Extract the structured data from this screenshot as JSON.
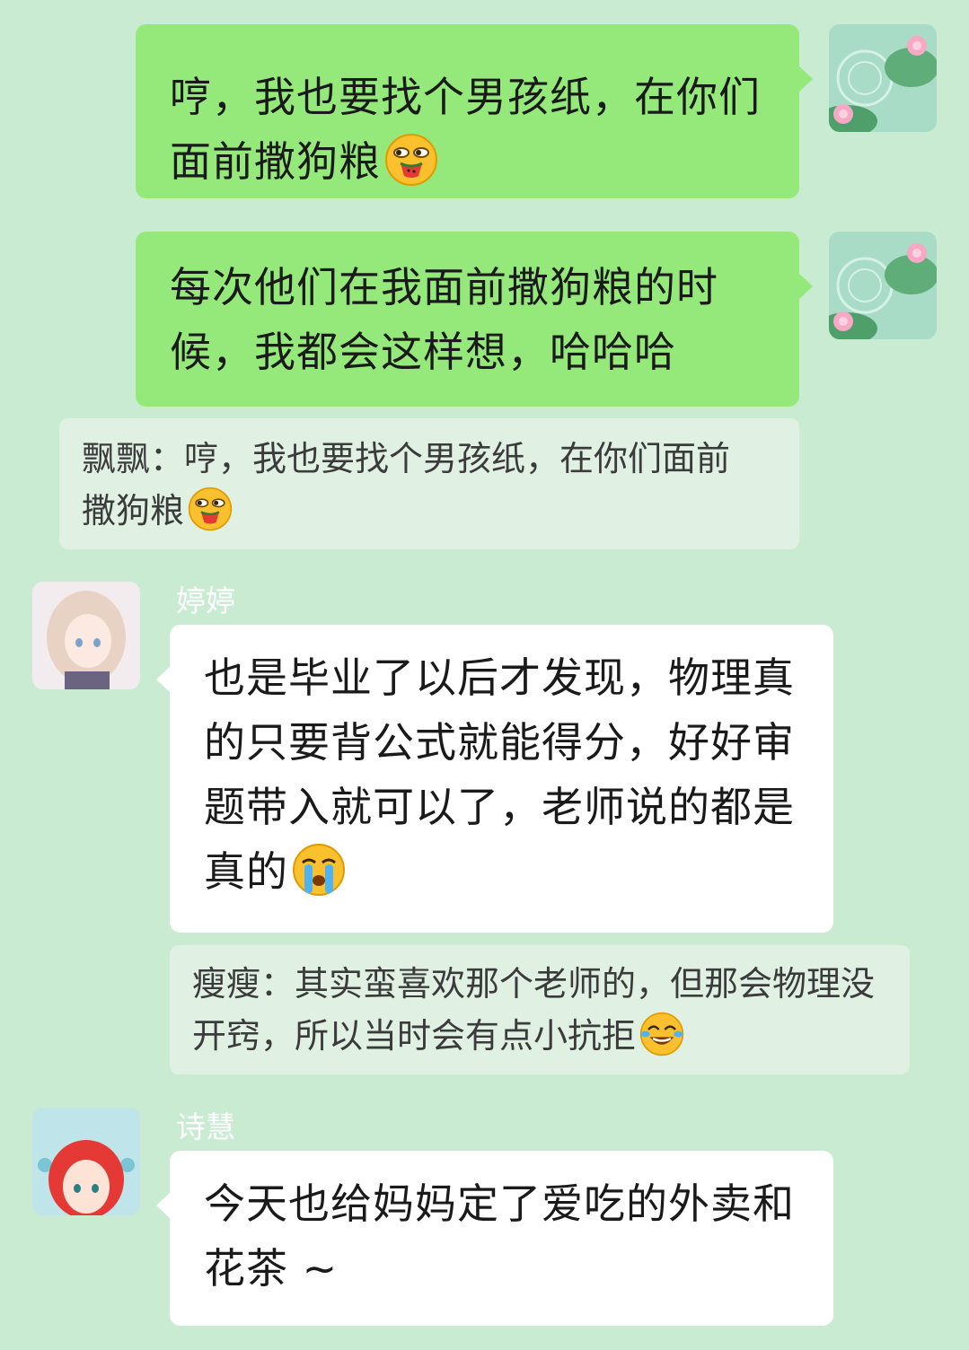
{
  "messages": [
    {
      "direction": "out",
      "text": "哼，我也要找个男孩纸，在你们面前撒狗粮",
      "emoji": "smirk-eating-watermelon-emoji"
    },
    {
      "direction": "out",
      "text": "每次他们在我面前撒狗粮的时候，我都会这样想，哈哈哈"
    },
    {
      "type": "quote",
      "text": "飘飘：哼，我也要找个男孩纸，在你们面前撒狗粮",
      "emoji": "smirk-eating-watermelon-emoji"
    },
    {
      "direction": "in",
      "sender": "婷婷",
      "text": "也是毕业了以后才发现，物理真的只要背公式就能得分，好好审题带入就可以了，老师说的都是真的",
      "emoji": "loudly-crying-emoji"
    },
    {
      "type": "quote",
      "text": "瘦瘦：其实蛮喜欢那个老师的，但那会物理没开窍，所以当时会有点小抗拒",
      "emoji": "tears-of-joy-emoji"
    },
    {
      "direction": "in",
      "sender": "诗慧",
      "text": "今天也给妈妈定了爱吃的外卖和花茶 ~"
    }
  ],
  "colors": {
    "background": "#c8ebd2",
    "outgoing_bubble": "#95e97b",
    "incoming_bubble": "#ffffff",
    "quote_bubble": "#e0f1e4"
  }
}
